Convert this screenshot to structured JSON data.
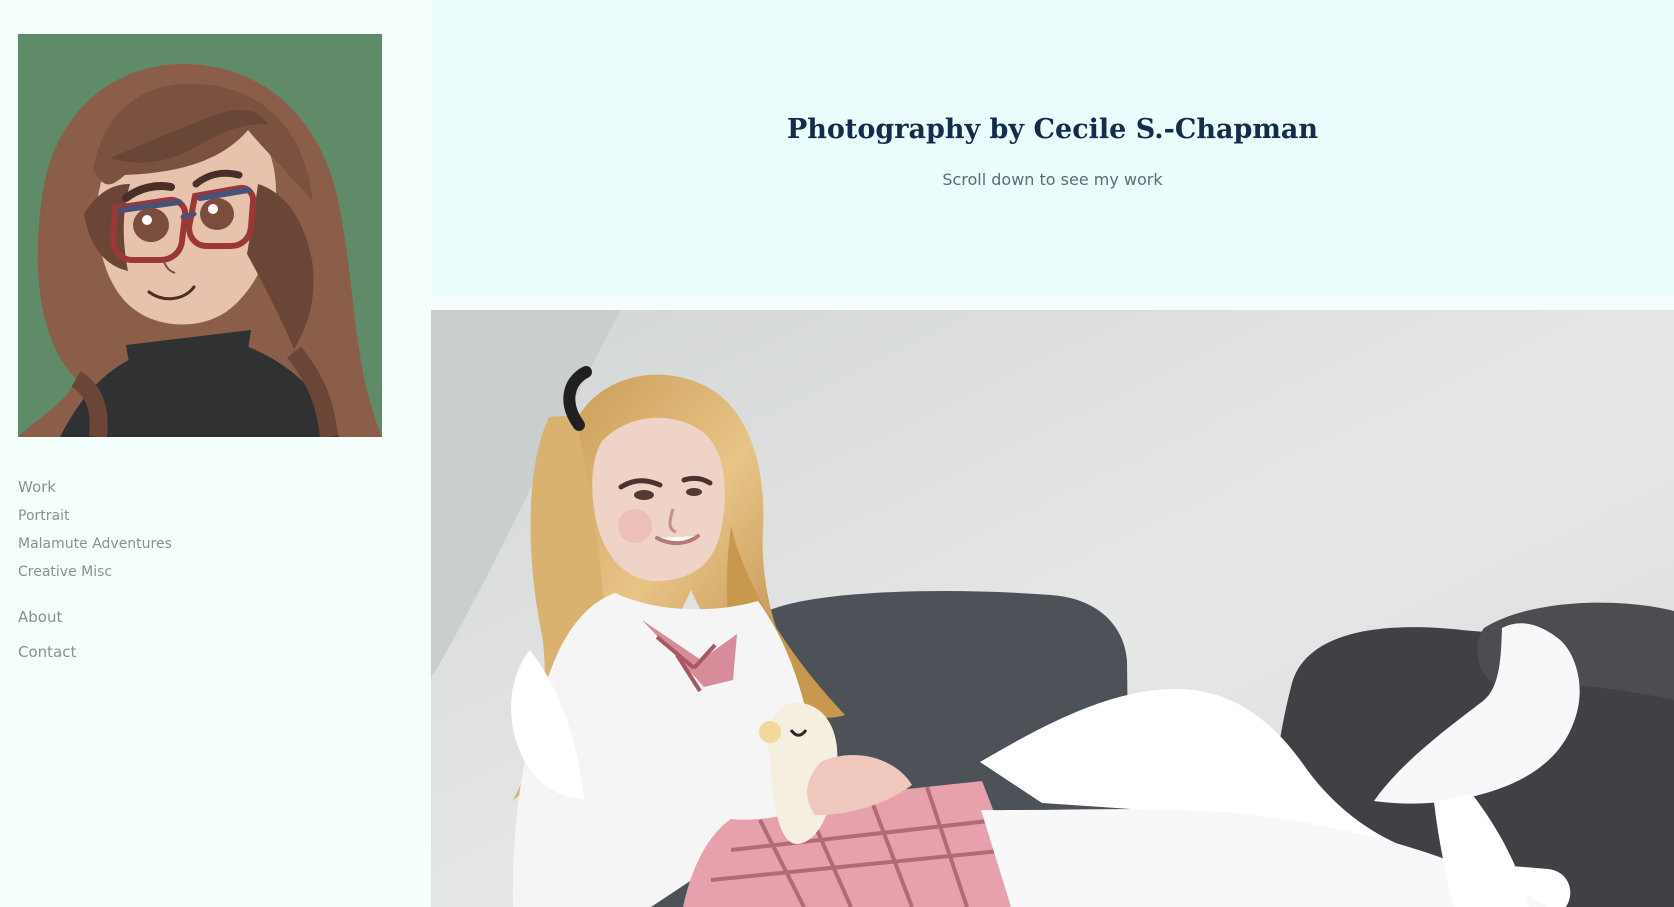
{
  "sidebar": {
    "nav": {
      "work": "Work",
      "portrait": "Portrait",
      "malamute": "Malamute Adventures",
      "creative": "Creative Misc",
      "about": "About",
      "contact": "Contact"
    }
  },
  "hero": {
    "title": "Photography by Cecile S.-Chapman",
    "subtitle": "Scroll down to see my work"
  },
  "colors": {
    "page_background": "#f5fffb",
    "hero_background": "#ebfdfd",
    "title_text": "#132c4d",
    "subtitle_text": "#5f6b73",
    "nav_text": "#8f8f8f",
    "avatar_background": "#5f8b69"
  }
}
